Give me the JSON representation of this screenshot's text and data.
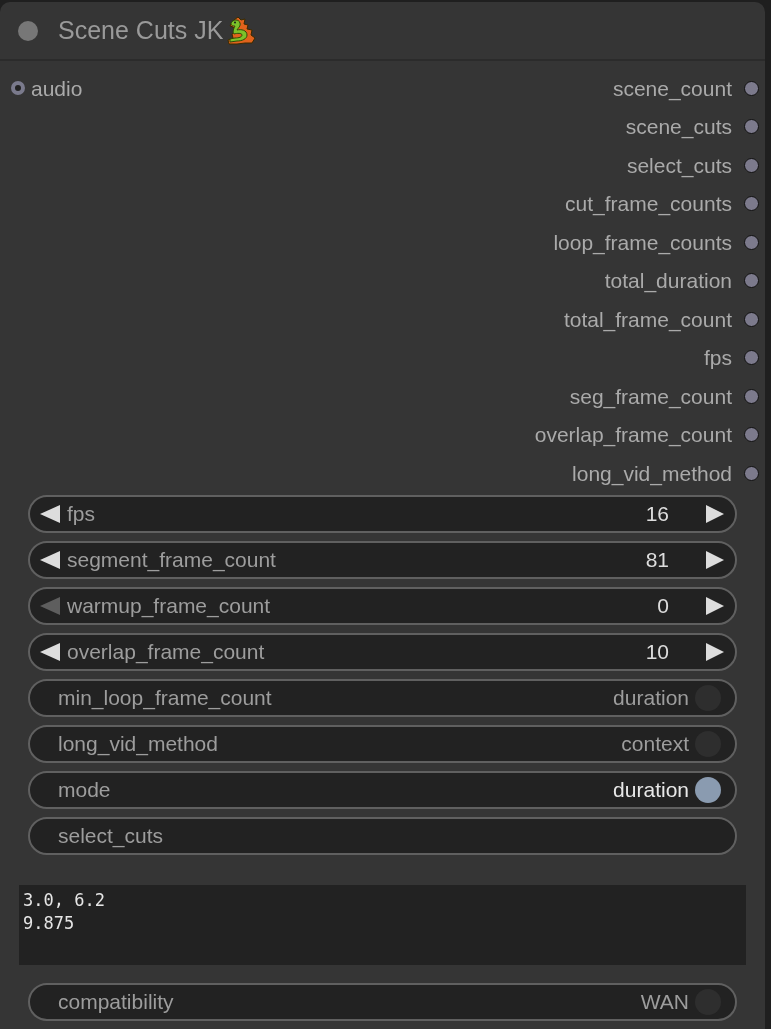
{
  "node": {
    "title": "Scene Cuts JK"
  },
  "inputs": [
    {
      "label": "audio"
    }
  ],
  "outputs": [
    "scene_count",
    "scene_cuts",
    "select_cuts",
    "cut_frame_counts",
    "loop_frame_counts",
    "total_duration",
    "total_frame_count",
    "fps",
    "seg_frame_count",
    "overlap_frame_count",
    "long_vid_method"
  ],
  "widgets": [
    {
      "kind": "number",
      "label": "fps",
      "value": "16",
      "left_disabled": false
    },
    {
      "kind": "number",
      "label": "segment_frame_count",
      "value": "81",
      "left_disabled": false
    },
    {
      "kind": "number",
      "label": "warmup_frame_count",
      "value": "0",
      "left_disabled": true
    },
    {
      "kind": "number",
      "label": "overlap_frame_count",
      "value": "10",
      "left_disabled": false
    },
    {
      "kind": "toggle",
      "label": "min_loop_frame_count",
      "value": "duration",
      "on": false
    },
    {
      "kind": "toggle",
      "label": "long_vid_method",
      "value": "context",
      "on": false
    },
    {
      "kind": "toggle",
      "label": "mode",
      "value": "duration",
      "on": true
    },
    {
      "kind": "text",
      "label": "select_cuts"
    },
    {
      "kind": "textarea",
      "lines": [
        "3.0, 6.2",
        "9.875"
      ]
    },
    {
      "kind": "toggle",
      "label": "compatibility",
      "value": "WAN",
      "on": false
    }
  ]
}
